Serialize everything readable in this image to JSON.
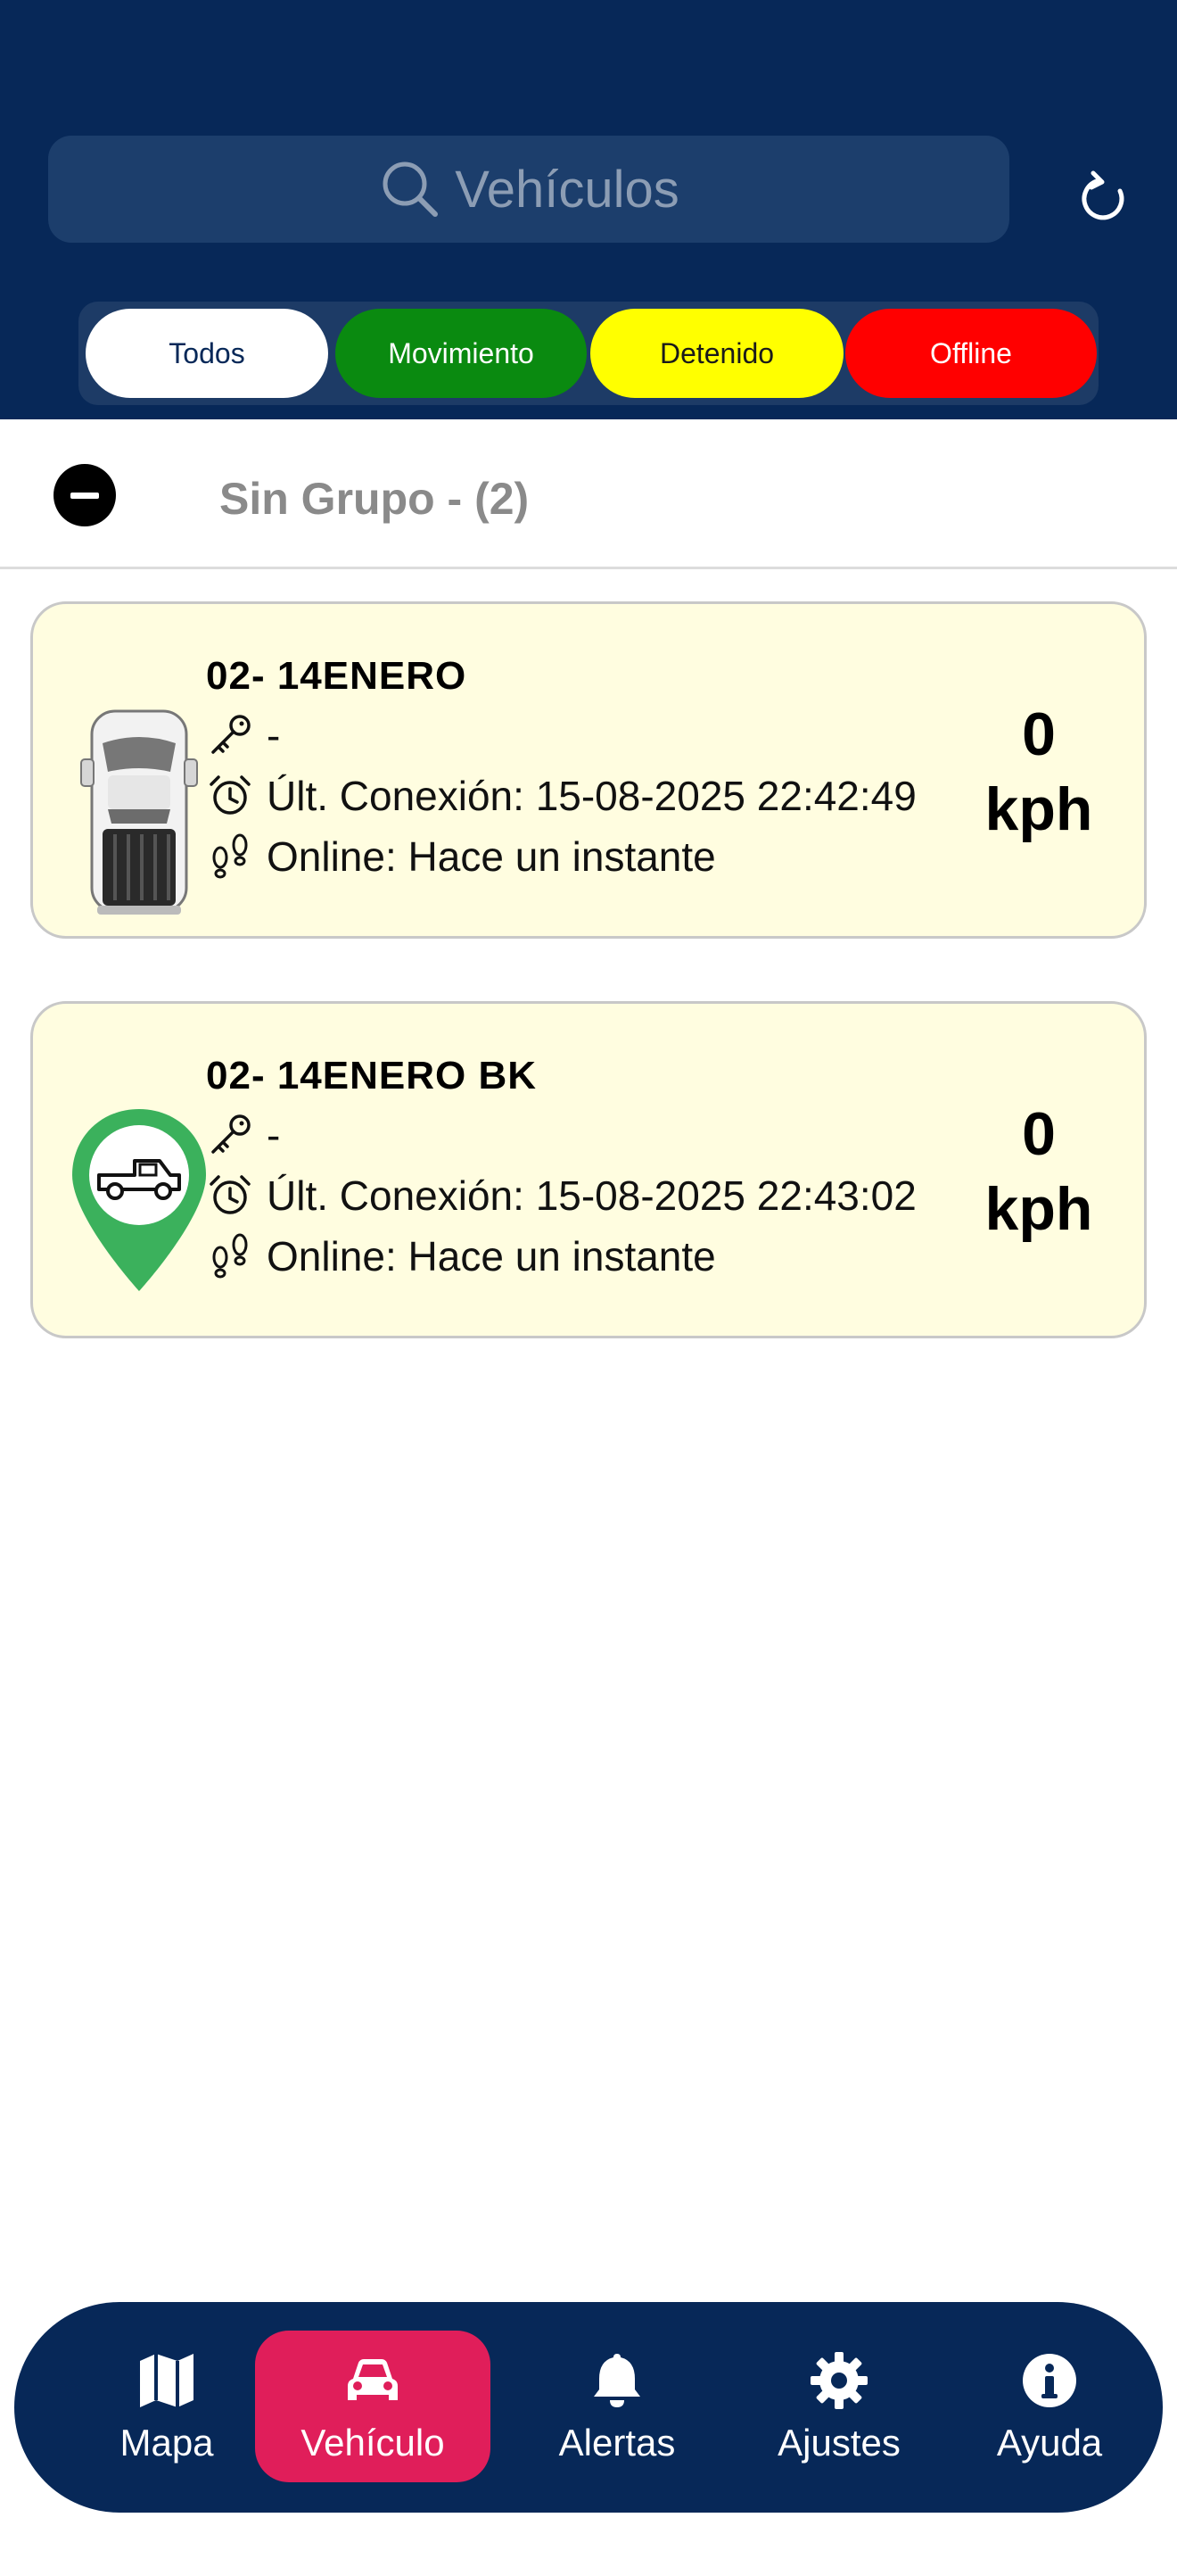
{
  "header": {
    "search_placeholder": "Vehículos",
    "filters": [
      "Todos",
      "Movimiento",
      "Detenido",
      "Offline"
    ]
  },
  "group": {
    "title": "Sin Grupo - (2)"
  },
  "vehicles": [
    {
      "name": "02- 14ENERO",
      "key": "-",
      "last_connection": "Últ. Conexión: 15-08-2025 22:42:49",
      "online": "Online: Hace un instante",
      "speed_value": "0",
      "speed_unit": "kph",
      "icon": "pickup-truck-top-view-icon"
    },
    {
      "name": "02- 14ENERO BK",
      "key": "-",
      "last_connection": "Últ. Conexión: 15-08-2025 22:43:02",
      "online": "Online: Hace un instante",
      "speed_value": "0",
      "speed_unit": "kph",
      "icon": "green-map-pin-truck-icon"
    }
  ],
  "nav": {
    "items": [
      {
        "label": "Mapa",
        "icon": "map-icon"
      },
      {
        "label": "Vehículo",
        "icon": "car-icon",
        "active": true
      },
      {
        "label": "Alertas",
        "icon": "bell-icon"
      },
      {
        "label": "Ajustes",
        "icon": "gear-icon"
      },
      {
        "label": "Ayuda",
        "icon": "info-icon"
      }
    ]
  },
  "colors": {
    "header_bg": "#072858",
    "active_nav": "#e01e5a",
    "filter_moving": "#0a8a10",
    "filter_stopped": "#ffff00",
    "filter_offline": "#ff0000",
    "card_bg": "#fffde0"
  }
}
